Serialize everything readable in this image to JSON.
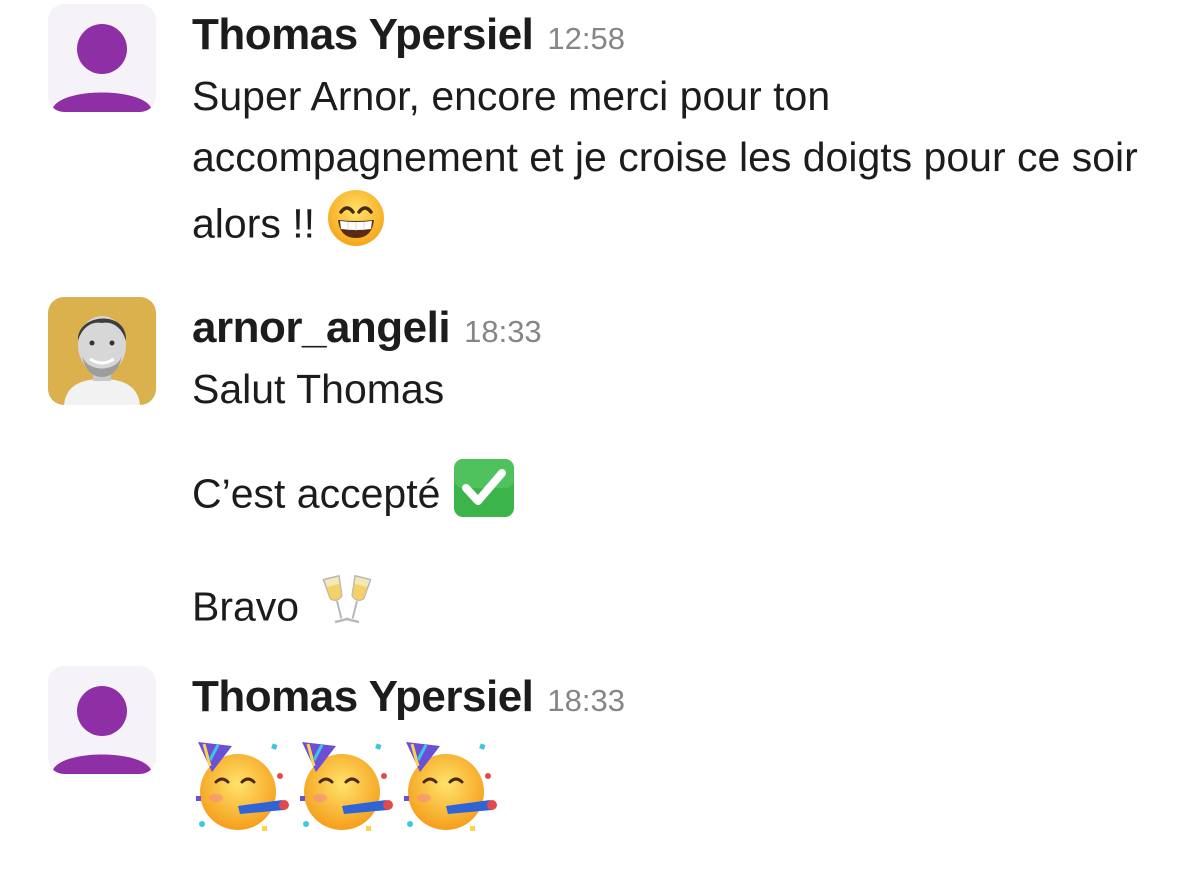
{
  "messages": [
    {
      "user": "Thomas Ypersiel",
      "time": "12:58",
      "avatar": "generic-user-avatar",
      "text": "Super Arnor, encore merci pour ton accompagnement et je croise les doigts pour ce soir alors !!",
      "emoji": "grinning-face-icon"
    },
    {
      "user": "arnor_angeli",
      "time": "18:33",
      "avatar": "user-photo-avatar",
      "paragraphs": [
        {
          "text": "Salut Thomas"
        },
        {
          "text": "C’est accepté",
          "emoji": "check-mark-button-icon"
        },
        {
          "text": "Bravo",
          "emoji": "clinking-glasses-icon"
        }
      ]
    },
    {
      "user": "Thomas Ypersiel",
      "time": "18:33",
      "avatar": "generic-user-avatar",
      "emojis": [
        "partying-face-icon",
        "partying-face-icon",
        "partying-face-icon"
      ]
    }
  ],
  "colors": {
    "avatar_generic_bg": "#f6f3f8",
    "avatar_generic_fg": "#8e2fa6",
    "avatar_photo_bg": "#dbb14d",
    "timestamp": "#868686",
    "text": "#1d1c1d",
    "check_green": "#3bb54a"
  }
}
